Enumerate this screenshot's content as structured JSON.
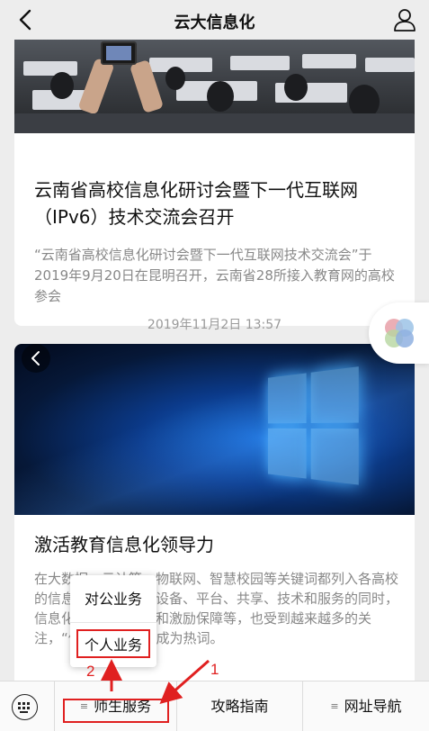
{
  "header": {
    "title": "云大信息化",
    "back_icon": "chevron-left-icon",
    "profile_icon": "person-icon"
  },
  "articles": [
    {
      "title": "云南省高校信息化研讨会暨下一代互联网（IPv6）技术交流会召开",
      "description": "“云南省高校信息化研讨会暨下一代互联网技术交流会”于2019年9月20日在昆明召开，云南省28所接入教育网的高校参会"
    },
    {
      "title": "激活教育信息化领导力",
      "description": "在大数据、云计算、物联网、智慧校园等关键词都列入各高校的信息化规划，强调设备、平台、共享、技术和服务的同时，信息化的管理、运营和激励保障等，也受到越来越多的关注，“信息化领导力”成为热词。"
    }
  ],
  "timestamp": "2019年11月2日 13:57",
  "popup_menu": {
    "items": [
      "对公业务",
      "个人业务"
    ],
    "highlighted": "个人业务"
  },
  "bottom_menu": {
    "keyboard_icon": "keyboard-icon",
    "items": [
      {
        "label": "师生服务",
        "icon": "≡"
      },
      {
        "label": "攻略指南",
        "icon": ""
      },
      {
        "label": "网址导航",
        "icon": "≡"
      }
    ]
  },
  "annotations": {
    "step1": "1",
    "step2": "2",
    "color": "#e02020"
  },
  "colors": {
    "page_bg": "#ededed",
    "card_bg": "#ffffff",
    "annotation": "#e02020"
  }
}
